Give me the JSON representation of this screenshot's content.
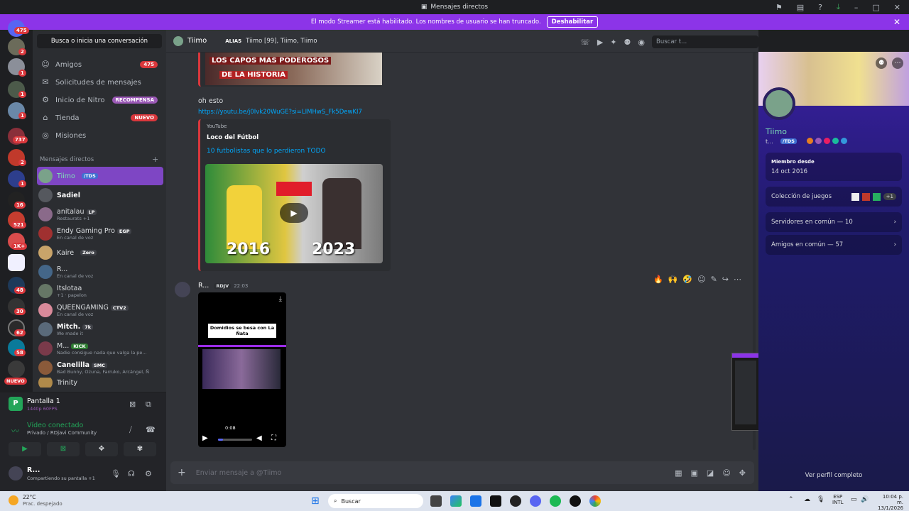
{
  "window": {
    "title": "Mensajes directos"
  },
  "banner": {
    "text": "El modo Streamer está habilitado. Los nombres de usuario se han truncado.",
    "button": "Deshabilitar"
  },
  "guilds": {
    "badges": [
      "475",
      "2",
      "1",
      "1",
      "1",
      "737",
      "2",
      "1",
      "16",
      "521",
      "1K+",
      "48",
      "30",
      "62",
      "58"
    ],
    "new_label": "NUEVO"
  },
  "sidebar": {
    "search": "Busca o inicia una conversación",
    "nav": [
      {
        "label": "Amigos",
        "badge": "475"
      },
      {
        "label": "Solicitudes de mensajes"
      },
      {
        "label": "Inicio de Nitro",
        "badge": "RECOMPENSA"
      },
      {
        "label": "Tienda",
        "badge": "NUEVO"
      },
      {
        "label": "Misiones"
      }
    ],
    "dm_header": "Mensajes directos",
    "dms": [
      {
        "name": "Tiimo",
        "tag": "/TDS",
        "sub": ""
      },
      {
        "name": "Sadiel",
        "tag": "",
        "sub": ""
      },
      {
        "name": "anitalau",
        "tag": "LP",
        "sub": "Restaurats +1"
      },
      {
        "name": "Endy Gaming Pro",
        "tag": "EGP",
        "sub": "En canal de voz"
      },
      {
        "name": "Kaire",
        "tag": "Zero",
        "sub": ""
      },
      {
        "name": "R...",
        "tag": "",
        "sub": "En canal de voz"
      },
      {
        "name": "Itslotaa",
        "tag": "",
        "sub": "+1 · papelon"
      },
      {
        "name": "QUEENGAMING",
        "tag": "CTV2",
        "sub": "En canal de voz"
      },
      {
        "name": "Mitch.",
        "tag": "7k",
        "sub": "We made it"
      },
      {
        "name": "M...",
        "tag": "KICK",
        "sub": "Nadie consigue nada que valga la pe..."
      },
      {
        "name": "Canelilla",
        "tag": "SMC",
        "sub": "Bad Bunny, Ozuna, Farruko, Arcángel, Ñ"
      },
      {
        "name": "Trinity",
        "tag": "",
        "sub": ""
      }
    ]
  },
  "voice": {
    "screen": "Pantalla 1",
    "screen_sub": "1440p 60FPS",
    "status": "Vídeo conectado",
    "channel": "Privado / RDjavi Community",
    "user": "R...",
    "user_sub": "Compartiendo su pantalla +1"
  },
  "chat": {
    "user": "Tiimo",
    "alias_label": "ALIAS",
    "alias": "Tiimo [99], Tiimo, Tiimo",
    "search_placeholder": "Buscar t...",
    "thumb1_text_line1": "LOS CAPOS MAS PODEROSOS",
    "thumb1_text_line2": "DE LA HISTORIA",
    "msg1": "oh esto",
    "link": "https://youtu.be/j0Ivk20WuGE?si=LIMHwS_Fk5DewKI7",
    "embed_provider": "YouTube",
    "embed_author": "Loco del Fútbol",
    "embed_title": "10 futbolistas que lo perdieron TODO",
    "year1": "2016",
    "year2": "2023",
    "msg2_author": "R...",
    "msg2_tag": "RDJV",
    "msg2_time": "22:03",
    "video_caption": "Domidios se besa con La Ñata",
    "video_time": "0:08",
    "video_progress": 0.15,
    "input_placeholder": "Enviar mensaje a @Tiimo"
  },
  "profile": {
    "name": "Tiimo",
    "short": "t...",
    "tag": "/TDS",
    "member_since_label": "Miembro desde",
    "member_since": "14 oct 2016",
    "games_label": "Colección de juegos",
    "games_more": "+1",
    "servers": "Servidores en común — 10",
    "friends": "Amigos en común — 57",
    "full": "Ver perfil completo"
  },
  "taskbar": {
    "weather_temp": "22°C",
    "weather_desc": "Prac. despejado",
    "search": "Buscar",
    "lang1": "ESP",
    "lang2": "INTL",
    "time": "10:04 p. m.",
    "date": "13/1/2026"
  }
}
